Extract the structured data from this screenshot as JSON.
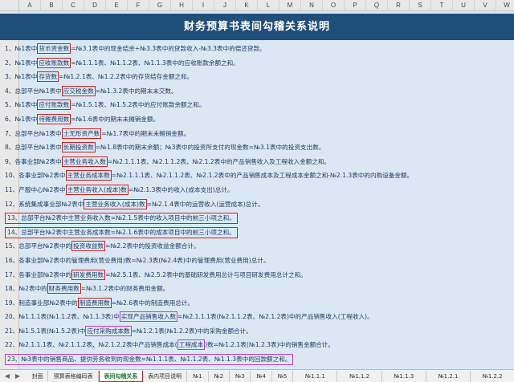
{
  "columns": [
    "A",
    "B",
    "C",
    "D",
    "E",
    "F",
    "G",
    "H",
    "I",
    "J",
    "K",
    "L",
    "M",
    "N",
    "O",
    "P",
    "Q",
    "R",
    "S",
    "T",
    "U",
    "V",
    "W"
  ],
  "title": "财务预算书表间勾稽关系说明",
  "items": [
    {
      "a": "1、№1表中",
      "b": "货币资金数",
      "c": "=№3.1表中的现金结余+№3.3表中的贷款收入-№3.3表中的偿还贷款。"
    },
    {
      "a": "2、№1表中",
      "b": "应收账款数",
      "c": "=№1.1.1表、№1.1.2表、№1.1.3表中的应收账款余额之和。"
    },
    {
      "a": "3、№1表中",
      "b": "存货数",
      "c": "=№1.2.1表、№1.2.2表中的存货结存金额之和。"
    },
    {
      "a": "4、总部平台№1表中",
      "b": "应交税金数",
      "c": "=№1.3.2表中的期末未交数。"
    },
    {
      "a": "5、№1表中",
      "b": "应付账款数",
      "c": "=№1.5.1表、№1.5.2表中的应付账款余额之和。"
    },
    {
      "a": "6、№1表中",
      "b": "待摊费用数",
      "c": "=№1.6表中的期末未摊销金额。"
    },
    {
      "a": "7、总部平台№1表中",
      "b": "土无形资产数",
      "c": "=№1.7表中的期末未摊销金额。"
    },
    {
      "a": "8、总部平台№1表中",
      "b": "长期投资数",
      "c": "=№1.8表中的期末余额；№3表中的投资所支付的现金数=№3.1表中的投资支出数。"
    },
    {
      "a": "9、各事业部№2表中",
      "b": "主营业务收入数",
      "c": "=№2.1.1.1表、№2.1.1.2表、№2.1.2表中的产品销售收入及工程收入金额之和。"
    },
    {
      "a": "10、各事业部№2表中",
      "b": "主营业务成本数",
      "c": "=№2.1.1.1表、№2.1.1.2表、№2.1.2表中的产品销售成本及工程成本金额之和-№2.1.3表中的内购设备金额。"
    },
    {
      "a": "11、产服中心№2表中",
      "b": "主营业务收入(成本)数",
      "c": "=№2.1.3表中的收入(成本支出)总计。"
    },
    {
      "a": "12、系统集成事业部№2表中",
      "b": "主营业务收入(成本)数",
      "c": "=№2.1.4表中的运营收入(运营成本)总计。"
    },
    {
      "boxed": true,
      "text": "13、总部平台№2表中主营业务收入数=№2.1.5表中的收入项目中的前三小项之和。"
    },
    {
      "boxed": true,
      "text": "14、总部平台№2表中主营业务成本数=№2.1.6表中的成本项目中的前三小项之和。"
    },
    {
      "a": "15、总部平台№2表中的",
      "b": "投资收益数",
      "c": "=№2.2表中的投资收益金额合计。"
    },
    {
      "a": "16、各事业部№2表中的管理费用(营业费用)数=№2.3表(№2.4表)中的管理费用(营业费用)总计。",
      "b": "",
      "c": ""
    },
    {
      "a": "17、各事业部№2表中的",
      "b": "研发费用数",
      "c": "=№2.5.1表、№2.5.2表中的基础研发费用总计与项目研发费用总计之和。"
    },
    {
      "a": "18、№2表中的",
      "b": "财务费用数",
      "c": "=№3.1.2表中的财务费用金额。"
    },
    {
      "a": "19、制造事业部№2表中的",
      "b": "制造费用数",
      "c": "=№2.6表中的制造费用总计。"
    },
    {
      "a": "20、№1.1.1表(№1.1.2表、№1.1.3表)中",
      "b": "实现产品销售收入数",
      "c": "=№2.1.1.1表(№2.1.1.2表、№2.1.2表)中的产品销售收入(工程收入)。",
      "pink": true
    },
    {
      "a": "21、№1.5.1表(№1.5.2表)中",
      "b": "应付采购成本数",
      "c": "=№1.2.1表(№1.2.2表)中的采购金额合计。",
      "pink": true
    },
    {
      "a": "22、№2.1.1.1表、№2.1.1.2表、№2.1.2.2表中产品销售成本(",
      "b": "工程成本",
      "c": ")数=№1.2.1表(№1.2.3表)中的销售金额合计。",
      "pink": true
    },
    {
      "boxed": true,
      "pink": true,
      "text": "23、№3表中的销售商品、提供劳务收到的现金数=№1.1.1表、№1.1.2表、№1.1.3表中的回款额之和。"
    }
  ],
  "tabs": [
    "封面",
    "预算表格编码表",
    "表间勾稽关系",
    "表内项目说明",
    "№1",
    "№2",
    "№3",
    "№4",
    "№5",
    "№1.1.1",
    "№1.1.2",
    "№1.1.3",
    "№1.2.1",
    "№1.2.2",
    "№"
  ],
  "active_tab": 2
}
